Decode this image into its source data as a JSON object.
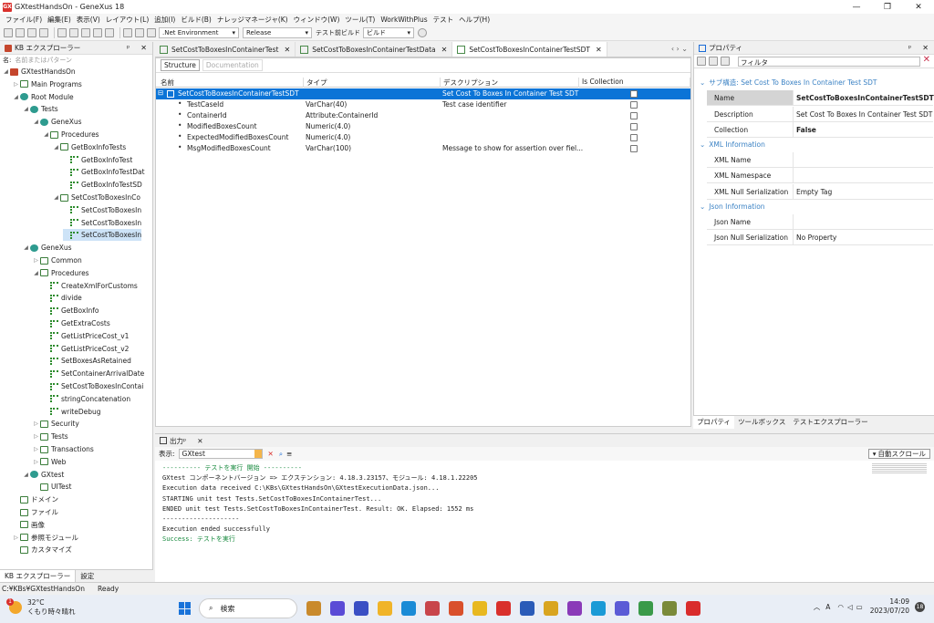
{
  "window": {
    "title": "GXtestHandsOn - GeneXus 18",
    "app_icon_text": "GX",
    "minimize": "—",
    "maximize": "❐",
    "close": "✕"
  },
  "menu": [
    "ファイル(F)",
    "編集(E)",
    "表示(V)",
    "レイアウト(L)",
    "追加(I)",
    "ビルド(B)",
    "ナレッジマネージャ(K)",
    "ウィンドウ(W)",
    "ツール(T)",
    "WorkWithPlus",
    "テスト",
    "ヘルプ(H)"
  ],
  "toolbar": {
    "environment": ".Net Environment",
    "configuration": "Release",
    "test_prebuild_label": "テスト前ビルド",
    "build_combo": "ビルド"
  },
  "kb_explorer": {
    "title": "KB エクスプローラー",
    "pin": "ᵖ",
    "close": "✕",
    "filter_label": "名:",
    "filter_placeholder": "名前またはパターン",
    "items": [
      {
        "label": "GXtestHandsOn",
        "indent": 0,
        "icon": "kb",
        "tw": "◢"
      },
      {
        "label": "Main Programs",
        "indent": 1,
        "icon": "folder",
        "tw": "▷"
      },
      {
        "label": "Root Module",
        "indent": 1,
        "icon": "mod",
        "tw": "◢"
      },
      {
        "label": "Tests",
        "indent": 2,
        "icon": "mod",
        "tw": "◢"
      },
      {
        "label": "GeneXus",
        "indent": 3,
        "icon": "mod",
        "tw": "◢"
      },
      {
        "label": "Procedures",
        "indent": 4,
        "icon": "folder",
        "tw": "◢"
      },
      {
        "label": "GetBoxInfoTests",
        "indent": 5,
        "icon": "folder",
        "tw": "◢"
      },
      {
        "label": "GetBoxInfoTest",
        "indent": 6,
        "icon": "proc",
        "tw": ""
      },
      {
        "label": "GetBoxInfoTestDat",
        "indent": 6,
        "icon": "proc",
        "tw": ""
      },
      {
        "label": "GetBoxInfoTestSD",
        "indent": 6,
        "icon": "proc",
        "tw": ""
      },
      {
        "label": "SetCostToBoxesInCo",
        "indent": 5,
        "icon": "folder",
        "tw": "◢"
      },
      {
        "label": "SetCostToBoxesIn",
        "indent": 6,
        "icon": "proc",
        "tw": ""
      },
      {
        "label": "SetCostToBoxesIn",
        "indent": 6,
        "icon": "proc",
        "tw": ""
      },
      {
        "label": "SetCostToBoxesIn",
        "indent": 6,
        "icon": "proc",
        "tw": "",
        "selected": true
      },
      {
        "label": "GeneXus",
        "indent": 2,
        "icon": "mod",
        "tw": "◢"
      },
      {
        "label": "Common",
        "indent": 3,
        "icon": "folder",
        "tw": "▷"
      },
      {
        "label": "Procedures",
        "indent": 3,
        "icon": "folder",
        "tw": "◢"
      },
      {
        "label": "CreateXmlForCustoms",
        "indent": 4,
        "icon": "proc",
        "tw": ""
      },
      {
        "label": "divide",
        "indent": 4,
        "icon": "proc",
        "tw": ""
      },
      {
        "label": "GetBoxInfo",
        "indent": 4,
        "icon": "proc",
        "tw": ""
      },
      {
        "label": "GetExtraCosts",
        "indent": 4,
        "icon": "proc",
        "tw": ""
      },
      {
        "label": "GetListPriceCost_v1",
        "indent": 4,
        "icon": "proc",
        "tw": ""
      },
      {
        "label": "GetListPriceCost_v2",
        "indent": 4,
        "icon": "proc",
        "tw": ""
      },
      {
        "label": "SetBoxesAsRetained",
        "indent": 4,
        "icon": "proc",
        "tw": ""
      },
      {
        "label": "SetContainerArrivalDate",
        "indent": 4,
        "icon": "proc",
        "tw": ""
      },
      {
        "label": "SetCostToBoxesInContai",
        "indent": 4,
        "icon": "proc",
        "tw": ""
      },
      {
        "label": "stringConcatenation",
        "indent": 4,
        "icon": "proc",
        "tw": ""
      },
      {
        "label": "writeDebug",
        "indent": 4,
        "icon": "proc",
        "tw": ""
      },
      {
        "label": "Security",
        "indent": 3,
        "icon": "folder",
        "tw": "▷"
      },
      {
        "label": "Tests",
        "indent": 3,
        "icon": "folder",
        "tw": "▷"
      },
      {
        "label": "Transactions",
        "indent": 3,
        "icon": "folder",
        "tw": "▷"
      },
      {
        "label": "Web",
        "indent": 3,
        "icon": "folder",
        "tw": "▷"
      },
      {
        "label": "GXtest",
        "indent": 2,
        "icon": "mod",
        "tw": "◢"
      },
      {
        "label": "UITest",
        "indent": 3,
        "icon": "folder",
        "tw": ""
      },
      {
        "label": "ドメイン",
        "indent": 1,
        "icon": "folder",
        "tw": ""
      },
      {
        "label": "ファイル",
        "indent": 1,
        "icon": "folder",
        "tw": ""
      },
      {
        "label": "画像",
        "indent": 1,
        "icon": "folder",
        "tw": ""
      },
      {
        "label": "参照モジュール",
        "indent": 1,
        "icon": "folder",
        "tw": "▷"
      },
      {
        "label": "カスタマイズ",
        "indent": 1,
        "icon": "folder",
        "tw": ""
      }
    ],
    "bottom_tabs": [
      "KB エクスプローラー",
      "設定"
    ]
  },
  "editor": {
    "tabs": [
      {
        "label": "SetCostToBoxesInContainerTest",
        "active": false
      },
      {
        "label": "SetCostToBoxesInContainerTestData",
        "active": false
      },
      {
        "label": "SetCostToBoxesInContainerTestSDT",
        "active": true
      }
    ],
    "nav": "‹ › ⌄",
    "subtabs": [
      "Structure",
      "Documentation"
    ],
    "columns": [
      "名前",
      "タイプ",
      "デスクリプション",
      "Is Collection"
    ],
    "rows": [
      {
        "name": "SetCostToBoxesInContainerTestSDT",
        "type": "",
        "desc": "Set Cost To Boxes In Container Test SDT",
        "root": true,
        "selected": true
      },
      {
        "name": "TestCaseId",
        "type": "VarChar(40)",
        "desc": "Test case identifier"
      },
      {
        "name": "ContainerId",
        "type": "Attribute:ContainerId",
        "desc": ""
      },
      {
        "name": "ModifiedBoxesCount",
        "type": "Numeric(4.0)",
        "desc": ""
      },
      {
        "name": "ExpectedModifiedBoxesCount",
        "type": "Numeric(4.0)",
        "desc": ""
      },
      {
        "name": "MsgModifiedBoxesCount",
        "type": "VarChar(100)",
        "desc": "Message to show for assertion over fiel..."
      }
    ]
  },
  "properties": {
    "title": "プロパティ",
    "filter_label": "フィルタ",
    "section_main": "サブ構造: Set Cost To Boxes In Container Test SDT",
    "rows_main": [
      {
        "k": "Name",
        "v": "SetCostToBoxesInContainerTestSDT",
        "bold": true,
        "hl": true
      },
      {
        "k": "Description",
        "v": "Set Cost To Boxes In Container Test SDT"
      },
      {
        "k": "Collection",
        "v": "False",
        "bold": true
      }
    ],
    "section_xml": "XML Information",
    "rows_xml": [
      {
        "k": "XML Name",
        "v": ""
      },
      {
        "k": "XML Namespace",
        "v": ""
      },
      {
        "k": "XML Null Serialization",
        "v": "Empty Tag"
      }
    ],
    "section_json": "Json Information",
    "rows_json": [
      {
        "k": "Json Name",
        "v": ""
      },
      {
        "k": "Json Null Serialization",
        "v": "No Property"
      }
    ],
    "bottom_tabs": [
      "プロパティ",
      "ツールボックス",
      "テストエクスプローラー"
    ]
  },
  "output": {
    "title": "出力",
    "show_label": "表示:",
    "source": "GXtest",
    "autoscroll": "自動スクロール",
    "lines": [
      {
        "t": "---------- テストを実行 開始 ----------",
        "green": true
      },
      {
        "t": "GXtest コンポーネントバージョン => エクステンション: 4.18.3.23157、モジュール: 4.18.1.22205"
      },
      {
        "t": "Execution data received C:\\KBs\\GXtestHandsOn\\GXtestExecutionData.json..."
      },
      {
        "t": "STARTING unit test Tests.SetCostToBoxesInContainerTest..."
      },
      {
        "t": "ENDED unit test Tests.SetCostToBoxesInContainerTest. Result: OK. Elapsed: 1552 ms"
      },
      {
        "t": "--------------------"
      },
      {
        "t": "Execution ended successfully"
      },
      {
        "t": "Success: テストを実行",
        "green": true
      }
    ]
  },
  "statusbar": {
    "path": "C:¥KBs¥GXtestHandsOn",
    "state": "Ready"
  },
  "taskbar": {
    "weather_temp": "32°C",
    "weather_desc": "くもり時々晴れ",
    "weather_badge": "1",
    "search_placeholder": "検索",
    "time": "14:09",
    "date": "2023/07/20",
    "notification_count": "18",
    "app_colors": [
      "#c98a2c",
      "#5a4bd6",
      "#3a4fc4",
      "#f0b429",
      "#1a8bd6",
      "#c8454b",
      "#d9502c",
      "#e8b820",
      "#d9302c",
      "#2a5bb8",
      "#d9a520",
      "#8a3ab8",
      "#1a9ad6",
      "#5b5bd6",
      "#3a9a4a",
      "#7a8a3a",
      "#d92c2c"
    ]
  }
}
